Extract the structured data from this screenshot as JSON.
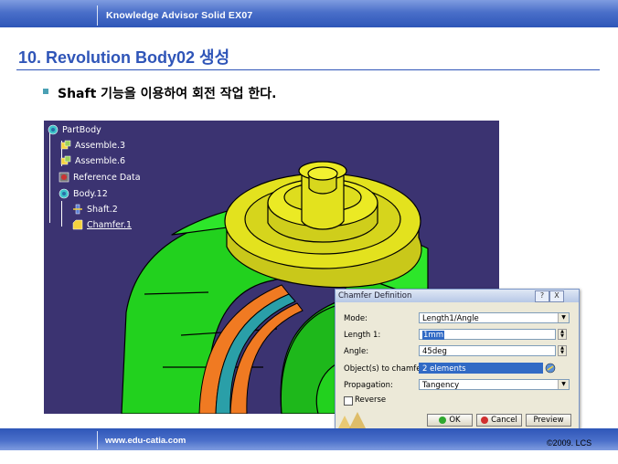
{
  "header": {
    "title": "Knowledge Advisor Solid EX07"
  },
  "slide": {
    "title": "10. Revolution Body02 생성",
    "bullet_bold": "Shaft",
    "bullet_rest": " 기능을 이용하여 회전 작업 한다."
  },
  "tree": {
    "items": [
      {
        "label": "PartBody",
        "icon": "part-gear-icon"
      },
      {
        "label": "Assemble.3",
        "icon": "assemble-icon"
      },
      {
        "label": "Assemble.6",
        "icon": "assemble-icon"
      },
      {
        "label": "Reference Data",
        "icon": "reference-icon"
      },
      {
        "label": "Body.12",
        "icon": "body-gear-icon"
      },
      {
        "label": "Shaft.2",
        "icon": "shaft-icon"
      },
      {
        "label": "Chamfer.1",
        "icon": "chamfer-icon"
      }
    ]
  },
  "dialog": {
    "title": "Chamfer Definition",
    "mode_label": "Mode:",
    "mode_value": "Length1/Angle",
    "length_label": "Length 1:",
    "length_value": "1mm",
    "angle_label": "Angle:",
    "angle_value": "45deg",
    "objects_label": "Object(s) to chamfer:",
    "objects_value": "2 elements",
    "propagation_label": "Propagation:",
    "propagation_value": "Tangency",
    "reverse_label": "Reverse",
    "ok_label": "OK",
    "cancel_label": "Cancel",
    "preview_label": "Preview",
    "help_glyph": "?",
    "close_glyph": "X"
  },
  "footer": {
    "url": "www.edu-catia.com",
    "copyright": "©2009. LCS"
  },
  "colors": {
    "brand_blue": "#2f55b8",
    "viewport_bg": "#3b3371",
    "model_green": "#22d11e",
    "model_yellow": "#e3e21e",
    "highlight_orange": "#f07a22",
    "highlight_cyan": "#2a9fa8"
  }
}
